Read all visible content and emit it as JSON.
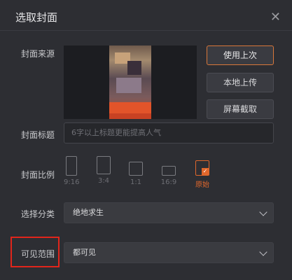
{
  "dialog": {
    "title": "选取封面",
    "close_icon": "close-icon"
  },
  "cover_source": {
    "label": "封面来源",
    "buttons": {
      "use_last": "使用上次",
      "local_upload": "本地上传",
      "screenshot": "屏幕截取"
    },
    "active_button": "use_last"
  },
  "cover_title": {
    "label": "封面标题",
    "placeholder": "6字以上标题更能提高人气",
    "value": ""
  },
  "cover_ratio": {
    "label": "封面比例",
    "options": [
      "9:16",
      "3:4",
      "1:1",
      "16:9",
      "原始"
    ],
    "selected": "原始"
  },
  "category": {
    "label": "选择分类",
    "value": "绝地求生"
  },
  "visibility": {
    "label": "可见范围",
    "value": "都可见"
  },
  "colors": {
    "accent": "#e0672c",
    "highlight_box": "#e1251b",
    "background": "#2d2e33"
  }
}
